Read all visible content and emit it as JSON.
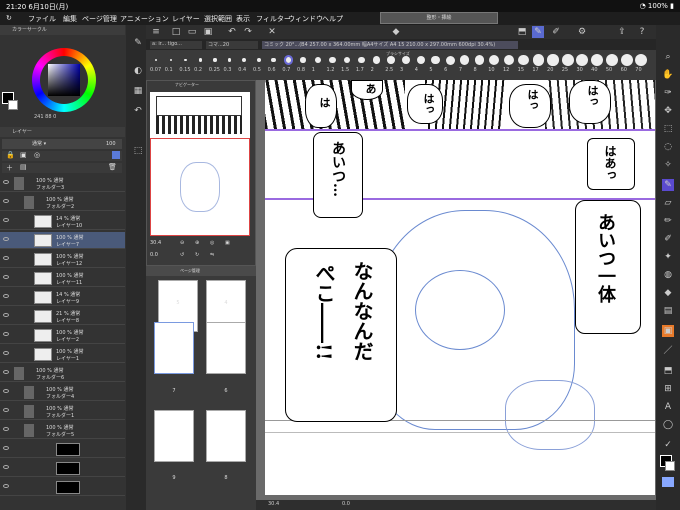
{
  "status": {
    "time": "21:20",
    "date": "6月10日(月)",
    "battery": "100%"
  },
  "menu": [
    "ファイル",
    "編集",
    "ページ管理",
    "アニメーション",
    "レイヤー",
    "選択範囲",
    "表示",
    "フィルター",
    "ウィンドウ",
    "ヘルプ"
  ],
  "title_box": "整形・挿絵",
  "color_panel": {
    "title": "カラーサークル",
    "readout": "241 88 0"
  },
  "layer_panel": {
    "title": "レイヤー",
    "blend": "通常",
    "opacity": "100"
  },
  "layers": [
    {
      "pct": "100 %",
      "mode": "通常",
      "name": "フォルダー3",
      "indent": 0,
      "type": "folder"
    },
    {
      "pct": "100 %",
      "mode": "通常",
      "name": "フォルダー2",
      "indent": 1,
      "type": "folder"
    },
    {
      "pct": "14 %",
      "mode": "通常",
      "name": "レイヤー10",
      "indent": 2,
      "type": "layer"
    },
    {
      "pct": "100 %",
      "mode": "通常",
      "name": "レイヤー7",
      "indent": 2,
      "type": "layer",
      "selected": true
    },
    {
      "pct": "100 %",
      "mode": "通常",
      "name": "レイヤー12",
      "indent": 2,
      "type": "layer"
    },
    {
      "pct": "100 %",
      "mode": "通常",
      "name": "レイヤー11",
      "indent": 2,
      "type": "layer"
    },
    {
      "pct": "14 %",
      "mode": "通常",
      "name": "レイヤー9",
      "indent": 2,
      "type": "layer"
    },
    {
      "pct": "21 %",
      "mode": "通常",
      "name": "レイヤー8",
      "indent": 2,
      "type": "layer"
    },
    {
      "pct": "100 %",
      "mode": "通常",
      "name": "レイヤー2",
      "indent": 2,
      "type": "layer"
    },
    {
      "pct": "100 %",
      "mode": "通常",
      "name": "レイヤー1",
      "indent": 2,
      "type": "layer"
    },
    {
      "pct": "100 %",
      "mode": "通常",
      "name": "フォルダー6",
      "indent": 0,
      "type": "folder"
    },
    {
      "pct": "100 %",
      "mode": "通常",
      "name": "フォルダー4",
      "indent": 1,
      "type": "folder"
    },
    {
      "pct": "100 %",
      "mode": "通常",
      "name": "フォルダー1",
      "indent": 1,
      "type": "folder"
    },
    {
      "pct": "100 %",
      "mode": "通常",
      "name": "フォルダー5",
      "indent": 1,
      "type": "folder"
    },
    {
      "pct": "",
      "mode": "",
      "name": "",
      "indent": 2,
      "type": "mask"
    },
    {
      "pct": "",
      "mode": "",
      "name": "",
      "indent": 2,
      "type": "mask"
    },
    {
      "pct": "",
      "mode": "",
      "name": "",
      "indent": 2,
      "type": "mask"
    }
  ],
  "tabs": [
    {
      "label": "a: ir... tigo..."
    },
    {
      "label": "コマ...20"
    }
  ],
  "doc_info": "コミック 20°...(B4 257.00 x 364.00mm 幅A4サイズ A4 15 210.00 x 297.00mm 600dpi 30.4%)",
  "brush_sizes": [
    "0.07",
    "0.1",
    "0.15",
    "0.2",
    "0.25",
    "0.3",
    "0.4",
    "0.5",
    "0.6",
    "0.7",
    "0.8",
    "1",
    "1.2",
    "1.5",
    "1.7",
    "2",
    "2.5",
    "3",
    "4",
    "5",
    "6",
    "7",
    "8",
    "10",
    "12",
    "15",
    "17",
    "20",
    "25",
    "30",
    "40",
    "50",
    "60",
    "70"
  ],
  "brush_panel_label": "ブラシサイズ",
  "navigator": {
    "title": "ナビゲーター",
    "zoom": "30.4",
    "rotate": "0.0"
  },
  "pages_panel": {
    "title": "ページ管理",
    "page_numbers": [
      "5",
      "4",
      "7",
      "6",
      "9",
      "8"
    ]
  },
  "canvas": {
    "zoom": "30.4",
    "rotate": "0.0"
  },
  "manga_text": {
    "a1": "あ",
    "ha1": "は",
    "ha2": "はっ",
    "ha3": "はっ",
    "ha4": "はっ",
    "haa": "はあっ",
    "aitsu": "あいつ…",
    "aitsu2": "あいつ一体",
    "nan1": "なんなんだ",
    "nan2": "ぺこ――!!"
  },
  "colors": {
    "accent": "#6a6ad8",
    "selected_layer": "#4a5a7a",
    "purple_rule": "#9a6ae0"
  }
}
